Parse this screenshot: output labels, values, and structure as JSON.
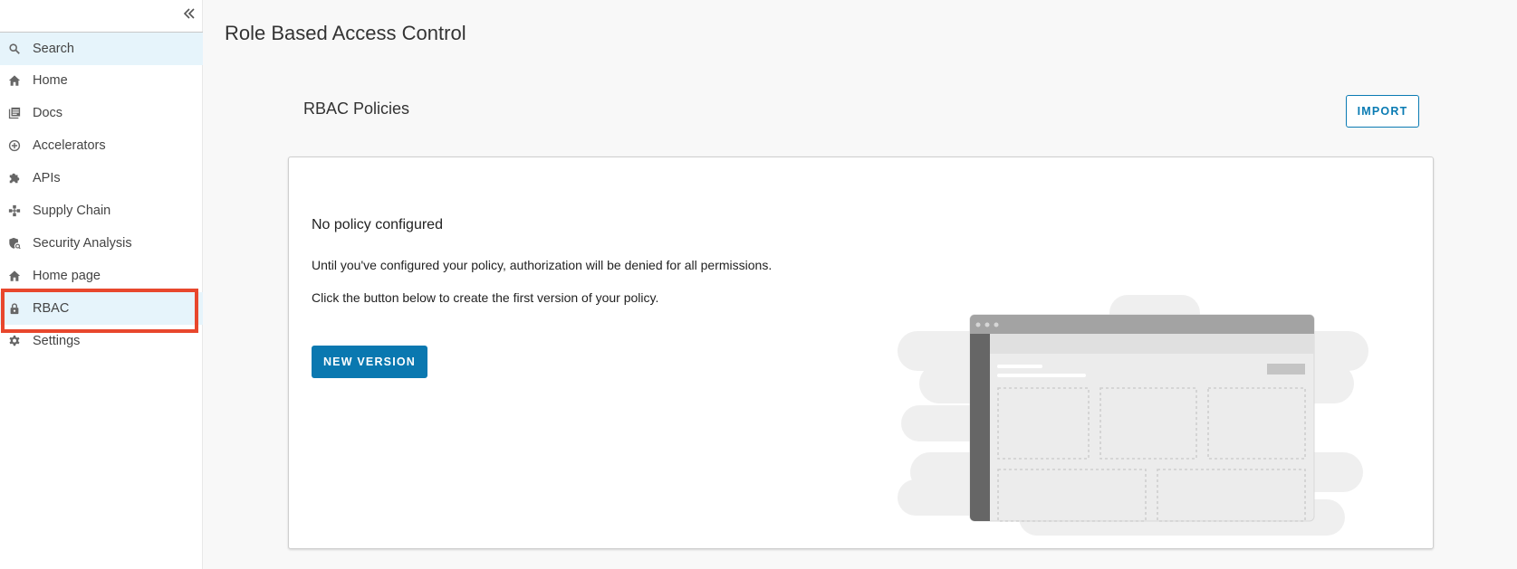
{
  "sidebar": {
    "collapse_icon": "double-chevron-left-icon",
    "items": [
      {
        "label": "Search",
        "icon": "search-icon"
      },
      {
        "label": "Home",
        "icon": "home-icon"
      },
      {
        "label": "Docs",
        "icon": "docs-icon"
      },
      {
        "label": "Accelerators",
        "icon": "plus-circle-icon"
      },
      {
        "label": "APIs",
        "icon": "puzzle-icon"
      },
      {
        "label": "Supply Chain",
        "icon": "supply-chain-icon"
      },
      {
        "label": "Security Analysis",
        "icon": "shield-search-icon"
      },
      {
        "label": "Home page",
        "icon": "home-icon"
      },
      {
        "label": "RBAC",
        "icon": "lock-icon"
      },
      {
        "label": "Settings",
        "icon": "gear-icon"
      }
    ],
    "active_item": "RBAC",
    "highlight_color": "#e8472d",
    "active_bg": "#e6f4fb"
  },
  "main": {
    "page_title": "Role Based Access Control",
    "section_title": "RBAC Policies",
    "import_label": "IMPORT",
    "empty_state": {
      "title": "No policy configured",
      "line1": "Until you've configured your policy, authorization will be denied for all permissions.",
      "line2": "Click the button below to create the first version of your policy.",
      "button_label": "NEW VERSION"
    },
    "accent_color": "#0a78b0"
  }
}
